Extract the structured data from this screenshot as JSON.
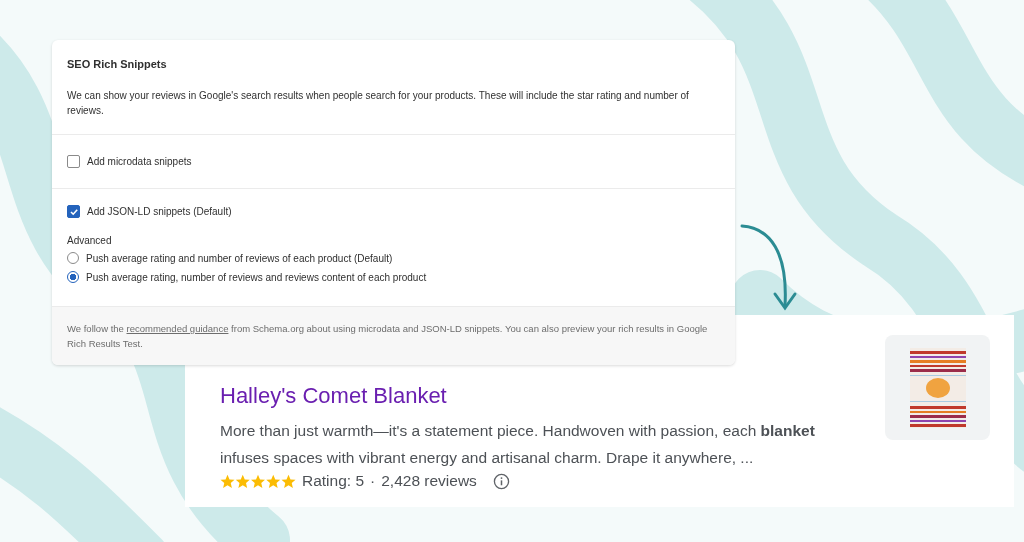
{
  "settings_card": {
    "title": "SEO Rich Snippets",
    "description": "We can show your reviews in Google's search results when people search for your products. These will include the star rating and number of reviews.",
    "microdata": {
      "label": "Add microdata snippets",
      "checked": false
    },
    "jsonld": {
      "label": "Add JSON-LD snippets (Default)",
      "checked": true
    },
    "advanced": {
      "label": "Advanced",
      "options": [
        {
          "label": "Push average rating and number of reviews of each product (Default)",
          "selected": false
        },
        {
          "label": "Push average rating, number of reviews and reviews content of each product",
          "selected": true
        }
      ]
    },
    "footer": {
      "before": "We follow the",
      "link": "recommended guidance",
      "after": "from Schema.org about using microdata and JSON-LD snippets. You can also preview your rich results in Google Rich Results Test."
    }
  },
  "search_result": {
    "title": "Halley's Comet Blanket",
    "snippet": "More than just warmth—it's a statement piece. Handwoven with passion, each **blanket** infuses spaces with vibrant energy and artisanal charm. Drape it anywhere, ...",
    "stars": 5,
    "rating": "Rating: 5",
    "separator": "·",
    "reviews": "2,428 reviews"
  }
}
